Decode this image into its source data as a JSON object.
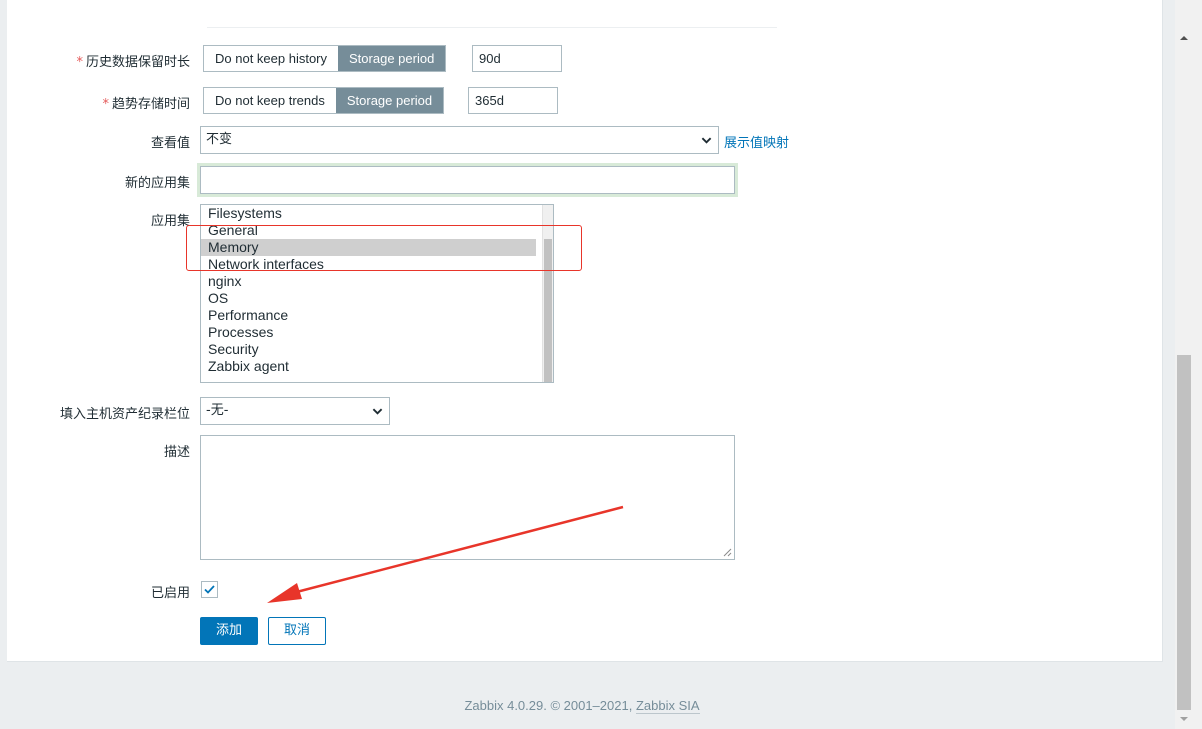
{
  "form": {
    "history": {
      "label": "历史数据保留时长",
      "required_mark": "*",
      "options": [
        "Do not keep history",
        "Storage period"
      ],
      "active_option": "Storage period",
      "value": "90d"
    },
    "trends": {
      "label": "趋势存储时间",
      "required_mark": "*",
      "options": [
        "Do not keep trends",
        "Storage period"
      ],
      "active_option": "Storage period",
      "value": "365d"
    },
    "show_value": {
      "label": "查看值",
      "selected": "不变",
      "mapping_link": "展示值映射"
    },
    "new_application": {
      "label": "新的应用集",
      "value": ""
    },
    "applications": {
      "label": "应用集",
      "items": [
        "Filesystems",
        "General",
        "Memory",
        "Network interfaces",
        "nginx",
        "OS",
        "Performance",
        "Processes",
        "Security",
        "Zabbix agent"
      ],
      "selected": "Memory"
    },
    "inventory": {
      "label": "填入主机资产纪录栏位",
      "selected": "-无-"
    },
    "description": {
      "label": "描述",
      "value": ""
    },
    "enabled": {
      "label": "已启用",
      "checked": true
    },
    "buttons": {
      "add": "添加",
      "cancel": "取消"
    }
  },
  "footer": {
    "text": "Zabbix 4.0.29. © 2001–2021,",
    "link": "Zabbix SIA"
  },
  "annotations": {
    "highlight_color": "#e8352a",
    "arrow_color": "#e8352a"
  },
  "colors": {
    "accent": "#0275b8",
    "segment_active": "#768d99"
  }
}
